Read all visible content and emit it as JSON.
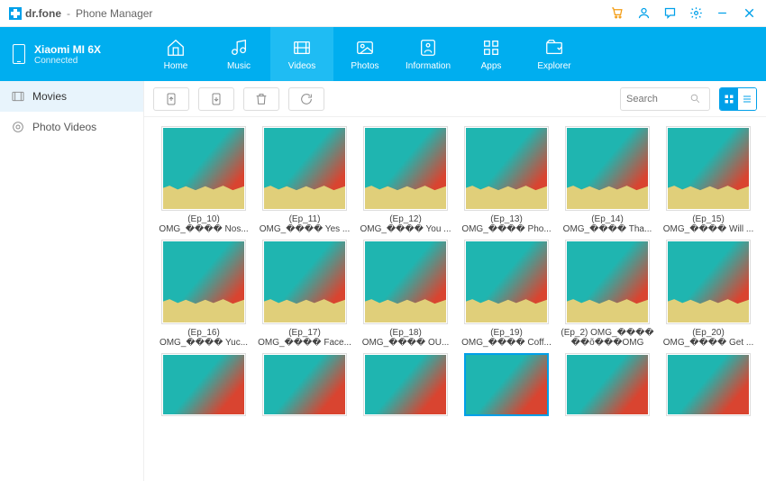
{
  "app": {
    "brand": "dr.fone",
    "title": "Phone Manager"
  },
  "device": {
    "name": "Xiaomi MI 6X",
    "status": "Connected"
  },
  "nav": [
    {
      "key": "home",
      "label": "Home"
    },
    {
      "key": "music",
      "label": "Music"
    },
    {
      "key": "videos",
      "label": "Videos",
      "active": true
    },
    {
      "key": "photos",
      "label": "Photos"
    },
    {
      "key": "information",
      "label": "Information"
    },
    {
      "key": "apps",
      "label": "Apps"
    },
    {
      "key": "explorer",
      "label": "Explorer"
    }
  ],
  "sidebar": [
    {
      "key": "movies",
      "label": "Movies",
      "active": true
    },
    {
      "key": "photo-videos",
      "label": "Photo Videos"
    }
  ],
  "toolbar": {
    "buttons": [
      "import",
      "export",
      "delete",
      "refresh"
    ]
  },
  "search": {
    "placeholder": "Search"
  },
  "view": {
    "mode": "grid"
  },
  "videos": [
    {
      "line1": "(Ep_10)",
      "line2": "OMG_���� Nos..."
    },
    {
      "line1": "(Ep_11)",
      "line2": "OMG_���� Yes ..."
    },
    {
      "line1": "(Ep_12)",
      "line2": "OMG_���� You ..."
    },
    {
      "line1": "(Ep_13)",
      "line2": "OMG_���� Pho..."
    },
    {
      "line1": "(Ep_14)",
      "line2": "OMG_���� Tha..."
    },
    {
      "line1": "(Ep_15)",
      "line2": "OMG_���� Will ..."
    },
    {
      "line1": "(Ep_16)",
      "line2": "OMG_���� Yuc..."
    },
    {
      "line1": "(Ep_17)",
      "line2": "OMG_���� Face..."
    },
    {
      "line1": "(Ep_18)",
      "line2": "OMG_���� OU..."
    },
    {
      "line1": "(Ep_19)",
      "line2": "OMG_���� Coff..."
    },
    {
      "line1": "(Ep_2) OMG_����",
      "line2": "��õ���OMG"
    },
    {
      "line1": "(Ep_20)",
      "line2": "OMG_���� Get ..."
    }
  ],
  "partial_row_count": 6,
  "selected_partial_index": 3
}
